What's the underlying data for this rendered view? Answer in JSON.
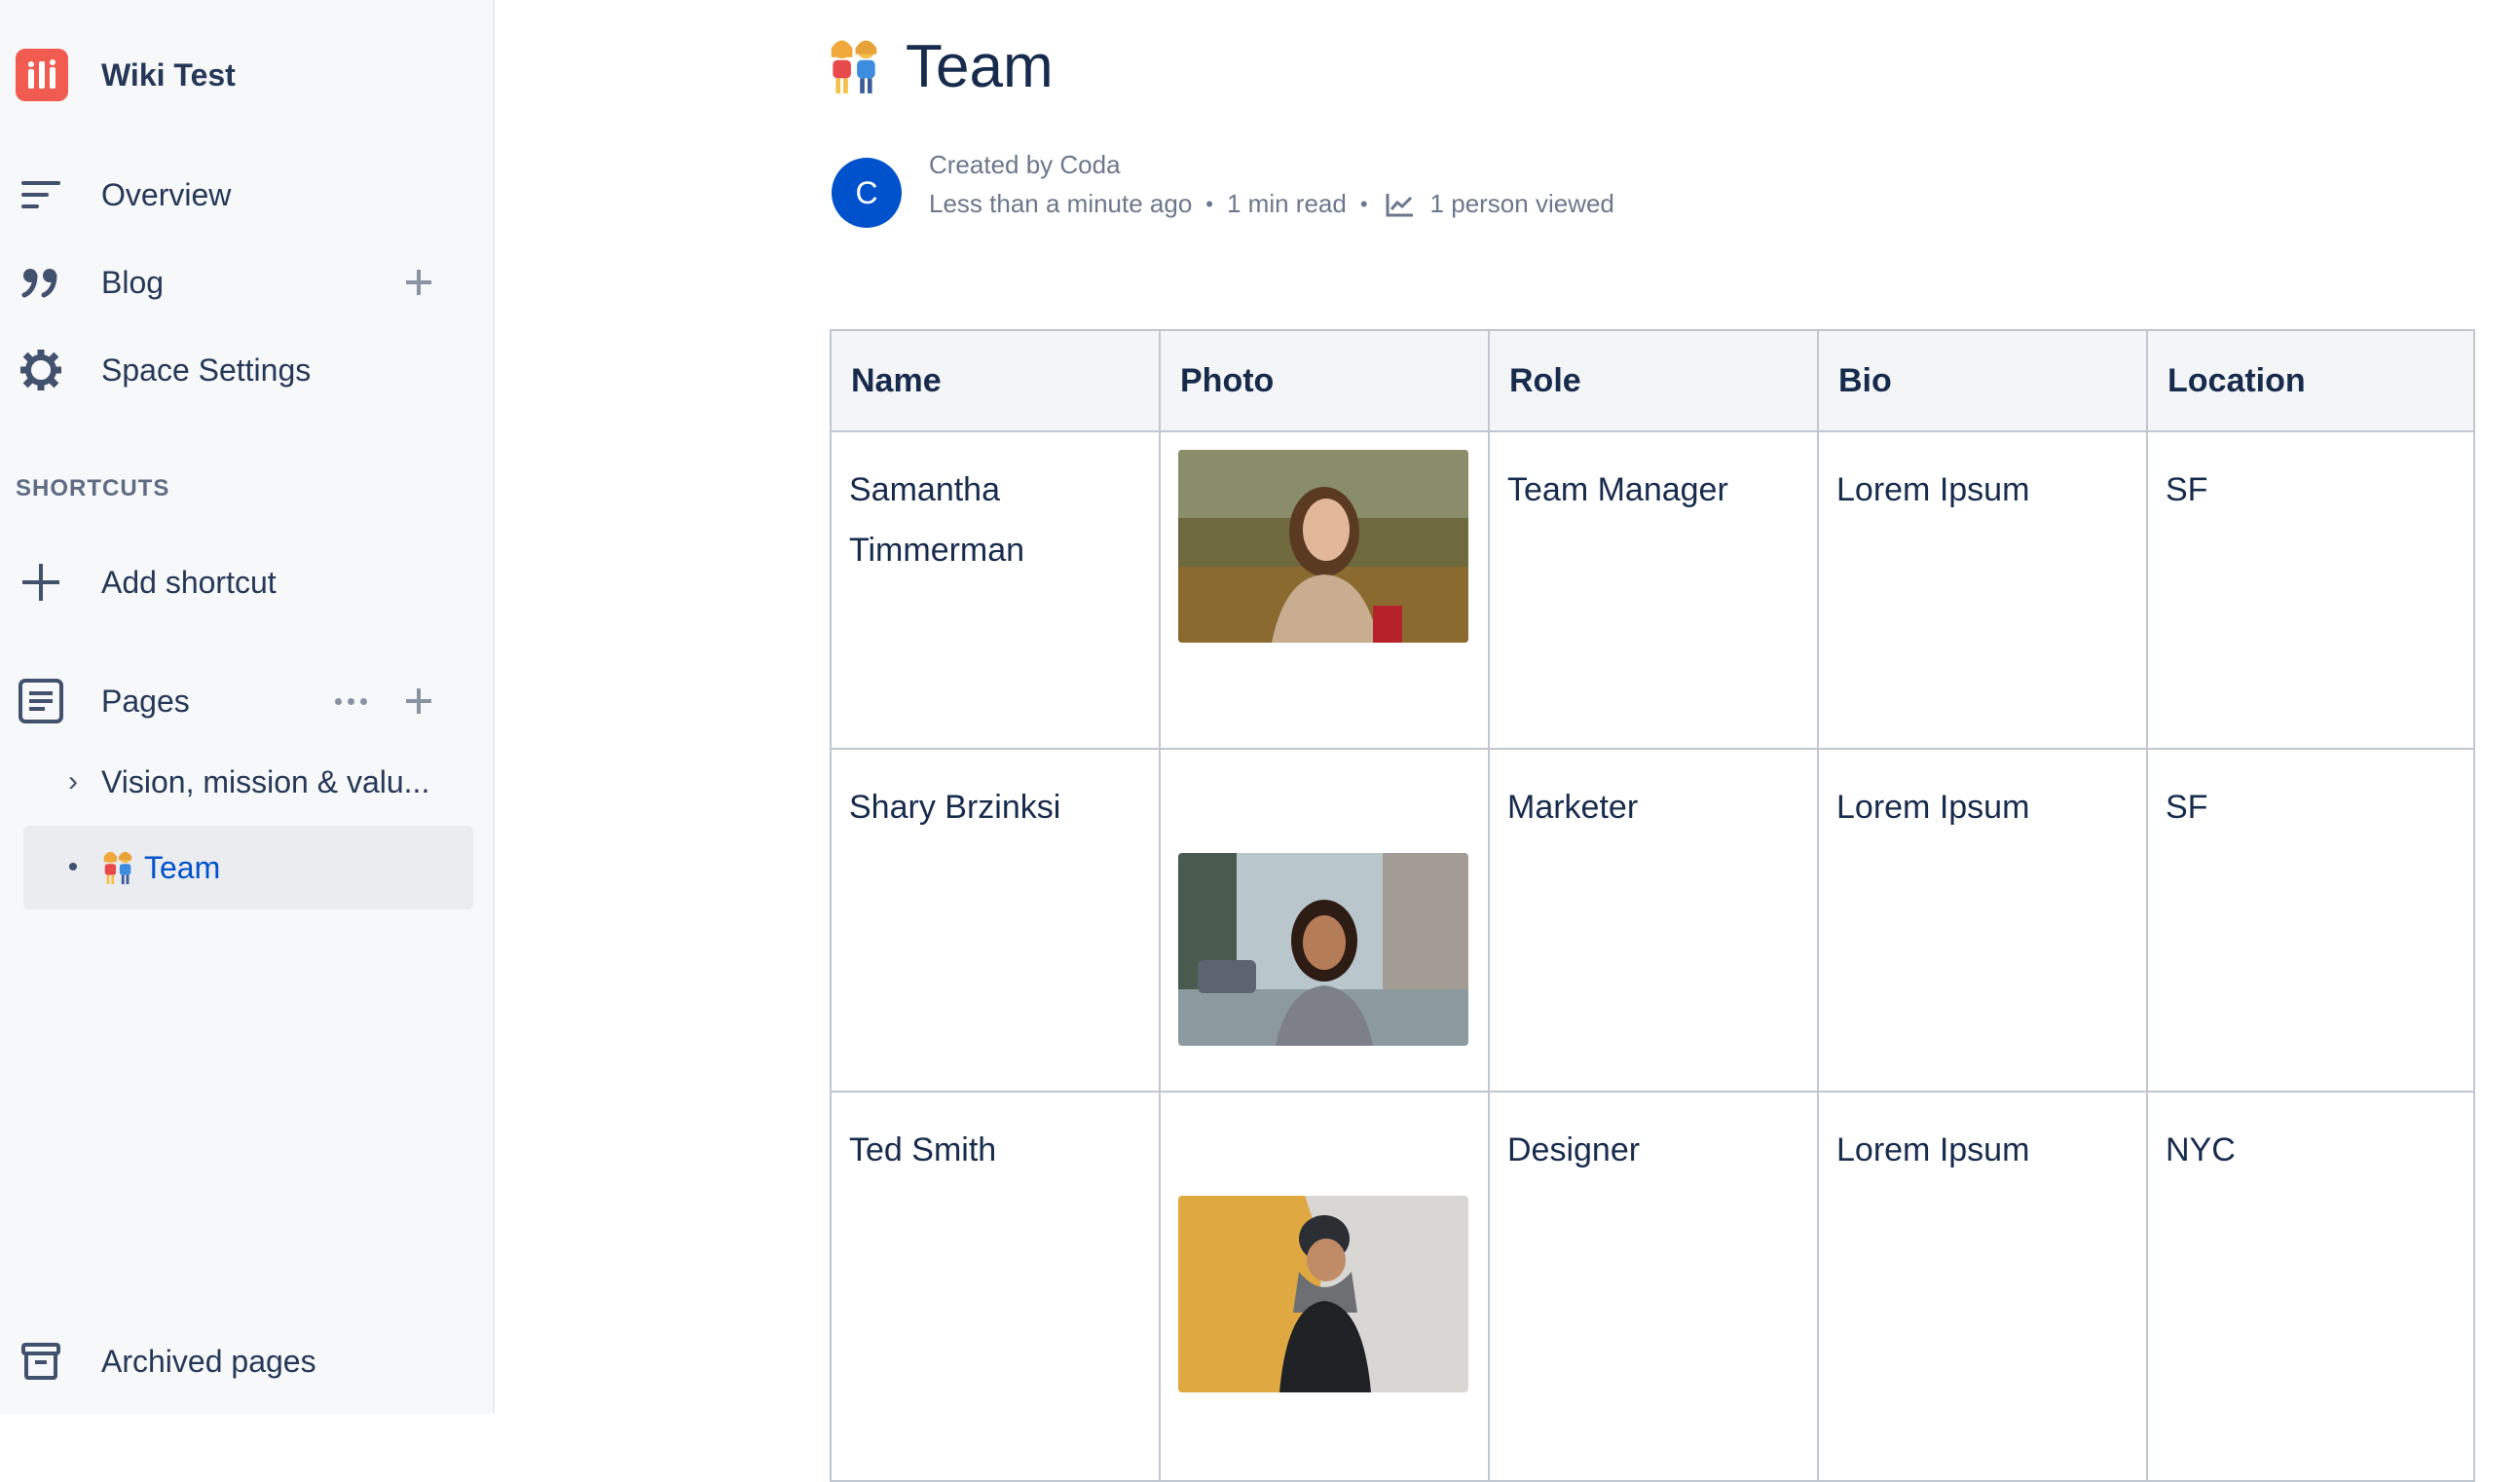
{
  "sidebar": {
    "space_name": "Wiki Test",
    "nav": [
      {
        "label": "Overview",
        "icon": "overview-lines-icon"
      },
      {
        "label": "Blog",
        "icon": "quote-icon"
      },
      {
        "label": "Space Settings",
        "icon": "gear-icon"
      }
    ],
    "shortcuts_heading": "SHORTCUTS",
    "add_shortcut": "Add shortcut",
    "pages_label": "Pages",
    "pages": [
      {
        "label": "Vision, mission & valu...",
        "marker": "›"
      },
      {
        "label": "Team",
        "marker": "•",
        "active": true
      }
    ],
    "archived_pages": "Archived pages"
  },
  "page": {
    "title": "Team",
    "author_initial": "C",
    "created_by": "Created by Coda",
    "updated": "Less than a minute ago",
    "read_time": "1 min read",
    "viewed": "1 person viewed"
  },
  "table": {
    "headers": [
      "Name",
      "Photo",
      "Role",
      "Bio",
      "Location"
    ],
    "rows": [
      {
        "name_line1": "Samantha",
        "name_line2": "Timmerman",
        "role": "Team Manager",
        "bio": "Lorem Ipsum",
        "location": "SF"
      },
      {
        "name_line1": "Shary Brzinksi",
        "name_line2": "",
        "role": "Marketer",
        "bio": "Lorem Ipsum",
        "location": "SF"
      },
      {
        "name_line1": "Ted Smith",
        "name_line2": "",
        "role": "Designer",
        "bio": "Lorem Ipsum",
        "location": "NYC"
      }
    ]
  },
  "colors": {
    "accent": "#0052cc",
    "space_logo": "#f15b50",
    "sidebar_bg": "#f7f8f9",
    "table_header_bg": "#f4f5f7"
  }
}
